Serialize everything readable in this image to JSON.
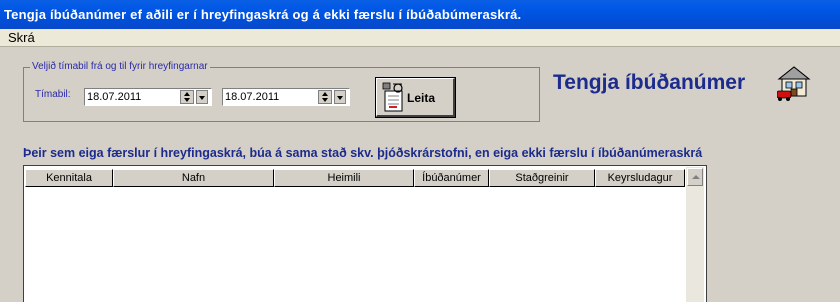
{
  "window": {
    "title": "Tengja íbúðanúmer ef aðili er í hreyfingaskrá og á ekki færslu í íbúðabúmeraskrá."
  },
  "menu": {
    "items": [
      {
        "label": "Skrá"
      }
    ]
  },
  "filter": {
    "legend": "Veljið tímabil frá og til fyrir hreyfingarnar",
    "period_label": "Tímabil:",
    "from_date": "18.07.2011",
    "to_date": "18.07.2011",
    "search_label": "Leita"
  },
  "header": {
    "app_title": "Tengja íbúðanúmer"
  },
  "grid": {
    "caption": "Þeir sem eiga færslur í hreyfingaskrá, búa á sama stað skv. þjóðskrárstofni, en eiga ekki færslu í íbúðanúmeraskrá",
    "columns": [
      "Kennitala",
      "Nafn",
      "Heimili",
      "Íbúðanúmer",
      "Staðgreinir",
      "Keyrsludagur"
    ],
    "rows": []
  },
  "colors": {
    "title_bar": "#0058e6",
    "accent_text": "#1c2b8c",
    "window_bg": "#d4d0c8"
  }
}
